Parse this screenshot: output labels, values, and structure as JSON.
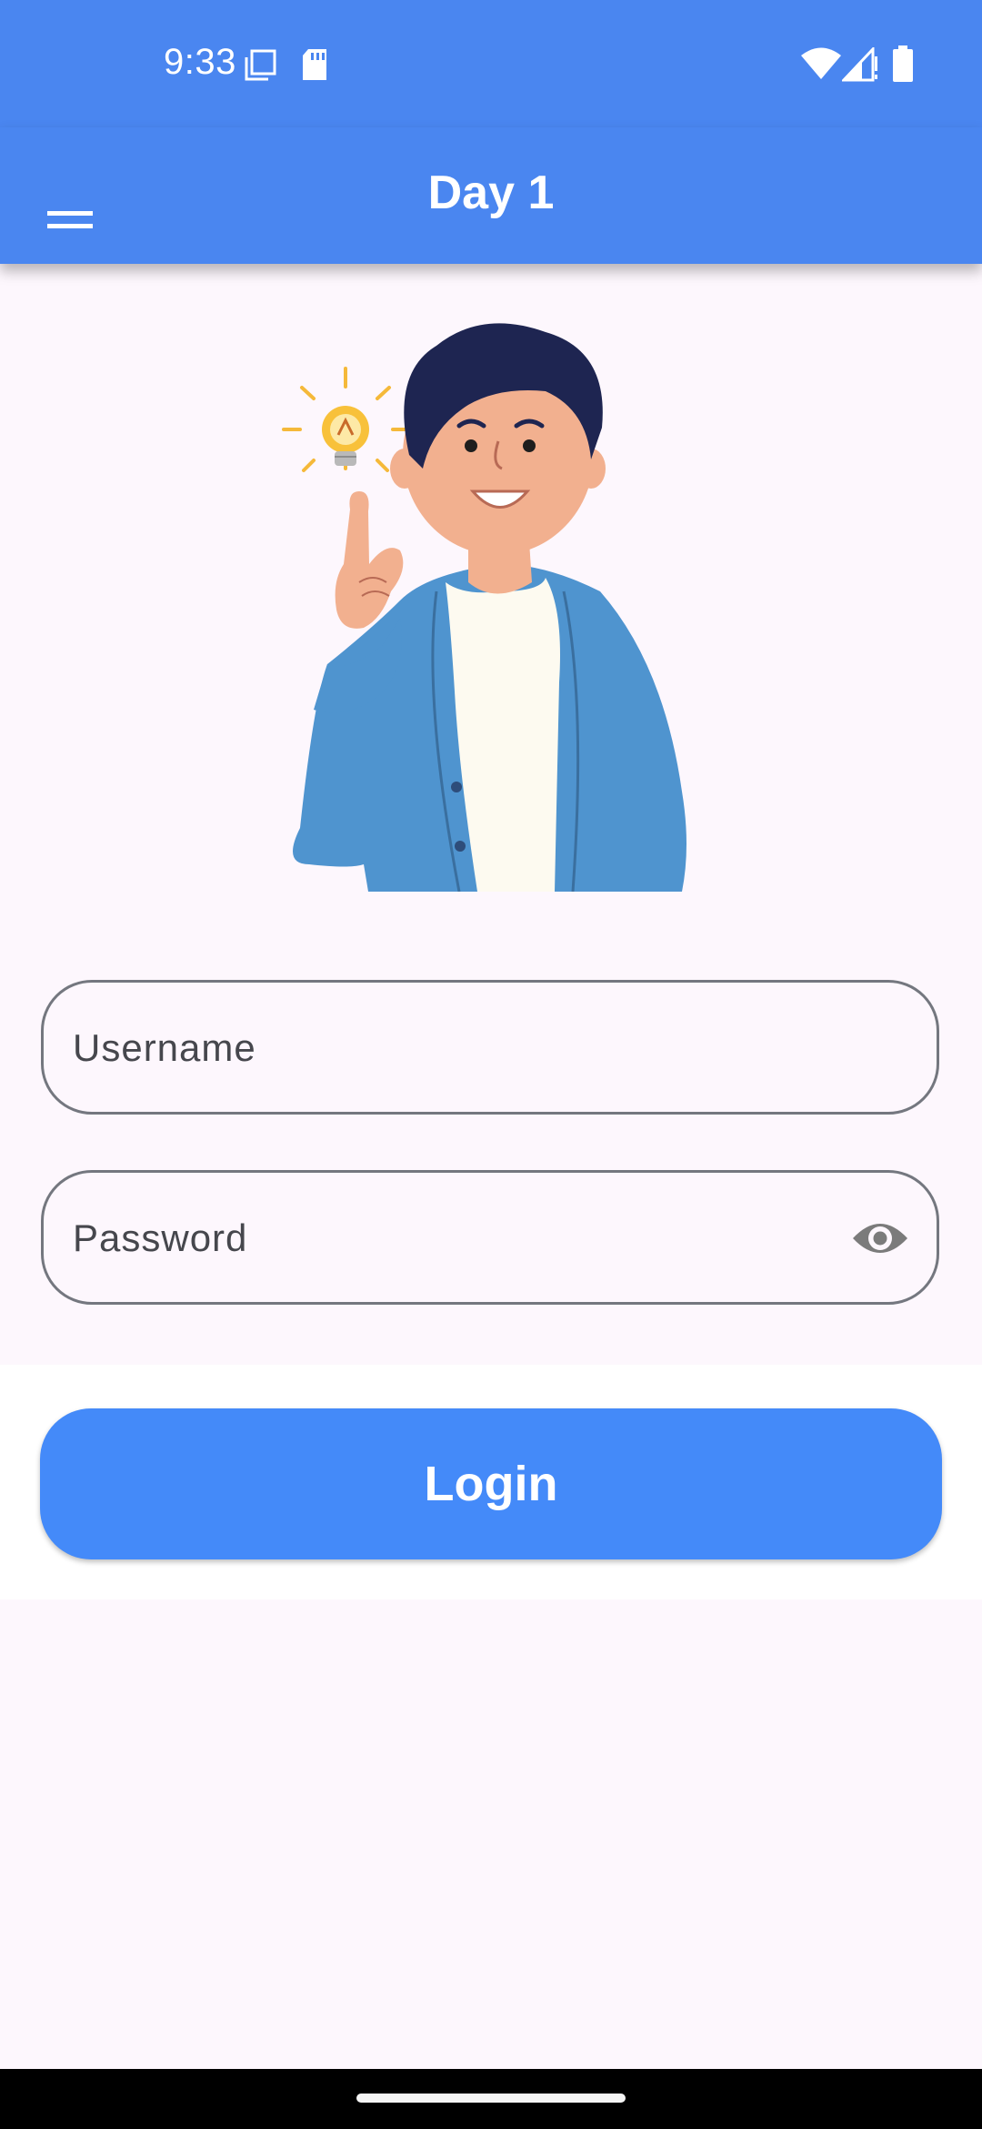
{
  "status_bar": {
    "time": "9:33",
    "icons": [
      "screenshot-icon",
      "sd-card-icon",
      "wifi-icon",
      "cell-signal-icon",
      "battery-icon"
    ]
  },
  "app_bar": {
    "title": "Day 1",
    "menu_icon": "hamburger-menu-icon"
  },
  "form": {
    "username": {
      "placeholder": "Username"
    },
    "password": {
      "placeholder": "Password",
      "toggle_icon": "eye-icon"
    }
  },
  "login_button": {
    "label": "Login"
  },
  "colors": {
    "app_bar": "#4a86f0",
    "button": "#448af9",
    "background": "#fdf7fd",
    "field_border": "#74777f"
  }
}
